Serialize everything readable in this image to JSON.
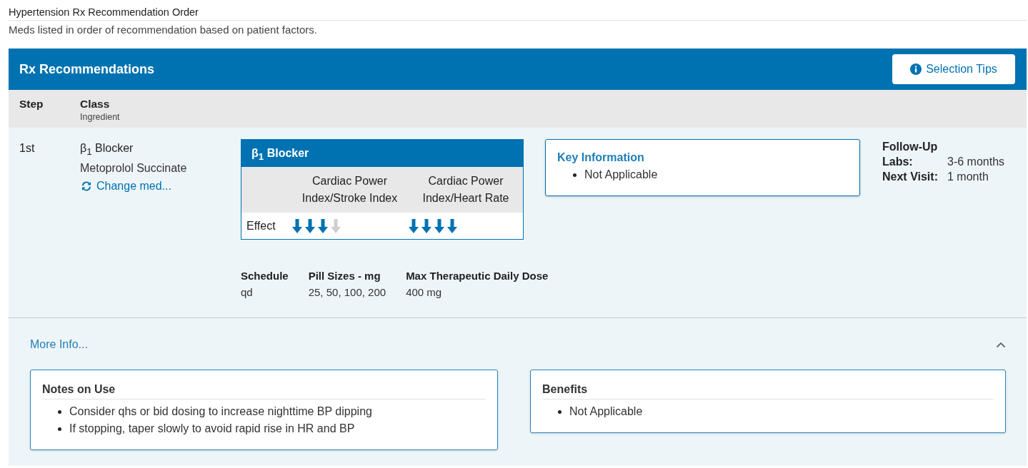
{
  "page": {
    "title": "Hypertension Rx Recommendation Order",
    "subtitle": "Meds listed in order of recommendation based on patient factors."
  },
  "panel": {
    "title": "Rx Recommendations",
    "tips_button": "Selection Tips"
  },
  "columns": {
    "step": "Step",
    "class": "Class",
    "ingredient": "Ingredient"
  },
  "recommendation": {
    "step": "1st",
    "class": "β$_{1}$ Blocker",
    "ingredient": "Metoprolol Succinate",
    "change_link": "Change med...",
    "effect_table": {
      "title": "β$_{1}$ Blocker",
      "row_label": "Effect",
      "measures": [
        {
          "label": "Cardiac Power Index/Stroke Index",
          "stars": 3
        },
        {
          "label": "Cardiac Power Index/Heart Rate",
          "stars": 4
        }
      ]
    },
    "dosing": [
      {
        "label": "Schedule",
        "value": "qd"
      },
      {
        "label": "Pill Sizes - mg",
        "value": "25, 50, 100, 200"
      },
      {
        "label": "Max Therapeutic Daily Dose",
        "value": "400 mg"
      }
    ],
    "key_information": {
      "title": "Key Information",
      "items": [
        "Not Applicable"
      ]
    },
    "follow_up": {
      "title": "Follow-Up",
      "items": [
        {
          "label": "Labs:",
          "value": "3-6 months"
        },
        {
          "label": "Next Visit:",
          "value": "1 month"
        }
      ]
    }
  },
  "more_info": {
    "label": "More Info...",
    "expanded": true,
    "cards": [
      {
        "title": "Notes on Use",
        "items": [
          "Consider qhs or bid dosing to increase nighttime BP dipping",
          "If stopping, taper slowly to avoid rapid rise in HR and BP"
        ]
      },
      {
        "title": "Benefits",
        "items": [
          "Not Applicable"
        ]
      }
    ]
  }
}
